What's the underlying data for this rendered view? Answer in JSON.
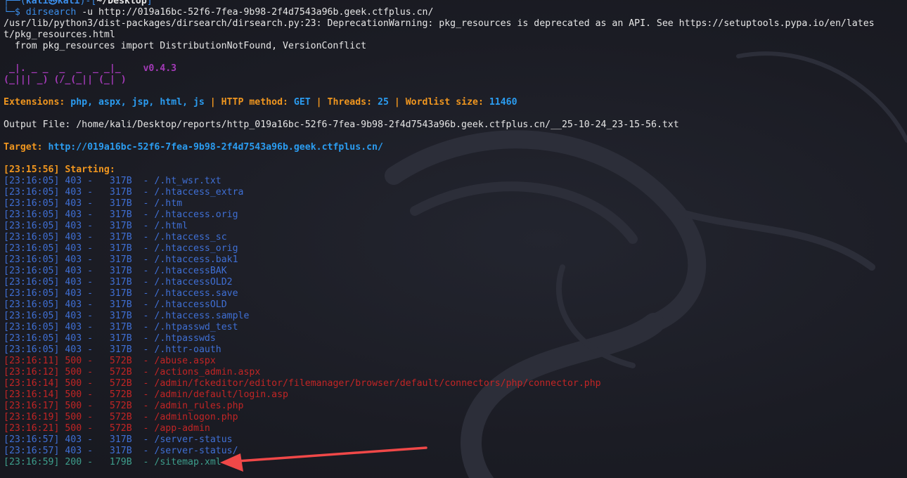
{
  "prompt": {
    "user": "kali",
    "at": "㉿",
    "host": "kali",
    "dir": "~/Desktop",
    "dollar": "$",
    "command": "dirsearch",
    "args": "-u http://019a16bc-52f6-7fea-9b98-2f4d7543a96b.geek.ctfplus.cn/"
  },
  "warning": {
    "line1": "/usr/lib/python3/dist-packages/dirsearch/dirsearch.py:23: DeprecationWarning: pkg_resources is deprecated as an API. See https://setuptools.pypa.io/en/lates",
    "line2": "t/pkg_resources.html",
    "line3": "  from pkg_resources import DistributionNotFound, VersionConflict"
  },
  "banner": {
    "art1": " _|. _ _  _  _  _ _|_    v0.4.3",
    "art2": "(_||| _) (/_(_|| (_| )"
  },
  "config": {
    "extensions_label": "Extensions: ",
    "extensions_value": "php, aspx, jsp, html, js",
    "method_label": "HTTP method: ",
    "method_value": "GET",
    "threads_label": "Threads: ",
    "threads_value": "25",
    "wordlist_label": "Wordlist size: ",
    "wordlist_value": "11460",
    "separator": " | "
  },
  "output_file": "Output File: /home/kali/Desktop/reports/http_019a16bc-52f6-7fea-9b98-2f4d7543a96b.geek.ctfplus.cn/__25-10-24_23-15-56.txt",
  "target": {
    "label": "Target: ",
    "url": "http://019a16bc-52f6-7fea-9b98-2f4d7543a96b.geek.ctfplus.cn/"
  },
  "starting": "[23:15:56] Starting: ",
  "results": [
    {
      "time": "[23:16:05]",
      "status": "403",
      "size": "317B",
      "path": "/.ht_wsr.txt",
      "color": "blue"
    },
    {
      "time": "[23:16:05]",
      "status": "403",
      "size": "317B",
      "path": "/.htaccess_extra",
      "color": "blue"
    },
    {
      "time": "[23:16:05]",
      "status": "403",
      "size": "317B",
      "path": "/.htm",
      "color": "blue"
    },
    {
      "time": "[23:16:05]",
      "status": "403",
      "size": "317B",
      "path": "/.htaccess.orig",
      "color": "blue"
    },
    {
      "time": "[23:16:05]",
      "status": "403",
      "size": "317B",
      "path": "/.html",
      "color": "blue"
    },
    {
      "time": "[23:16:05]",
      "status": "403",
      "size": "317B",
      "path": "/.htaccess_sc",
      "color": "blue"
    },
    {
      "time": "[23:16:05]",
      "status": "403",
      "size": "317B",
      "path": "/.htaccess_orig",
      "color": "blue"
    },
    {
      "time": "[23:16:05]",
      "status": "403",
      "size": "317B",
      "path": "/.htaccess.bak1",
      "color": "blue"
    },
    {
      "time": "[23:16:05]",
      "status": "403",
      "size": "317B",
      "path": "/.htaccessBAK",
      "color": "blue"
    },
    {
      "time": "[23:16:05]",
      "status": "403",
      "size": "317B",
      "path": "/.htaccessOLD2",
      "color": "blue"
    },
    {
      "time": "[23:16:05]",
      "status": "403",
      "size": "317B",
      "path": "/.htaccess.save",
      "color": "blue"
    },
    {
      "time": "[23:16:05]",
      "status": "403",
      "size": "317B",
      "path": "/.htaccessOLD",
      "color": "blue"
    },
    {
      "time": "[23:16:05]",
      "status": "403",
      "size": "317B",
      "path": "/.htaccess.sample",
      "color": "blue"
    },
    {
      "time": "[23:16:05]",
      "status": "403",
      "size": "317B",
      "path": "/.htpasswd_test",
      "color": "blue"
    },
    {
      "time": "[23:16:05]",
      "status": "403",
      "size": "317B",
      "path": "/.htpasswds",
      "color": "blue"
    },
    {
      "time": "[23:16:05]",
      "status": "403",
      "size": "317B",
      "path": "/.httr-oauth",
      "color": "blue"
    },
    {
      "time": "[23:16:11]",
      "status": "500",
      "size": "572B",
      "path": "/abuse.aspx",
      "color": "red"
    },
    {
      "time": "[23:16:12]",
      "status": "500",
      "size": "572B",
      "path": "/actions_admin.aspx",
      "color": "red"
    },
    {
      "time": "[23:16:14]",
      "status": "500",
      "size": "572B",
      "path": "/admin/fckeditor/editor/filemanager/browser/default/connectors/php/connector.php",
      "color": "red"
    },
    {
      "time": "[23:16:14]",
      "status": "500",
      "size": "572B",
      "path": "/admin/default/login.asp",
      "color": "red"
    },
    {
      "time": "[23:16:17]",
      "status": "500",
      "size": "572B",
      "path": "/admin_rules.php",
      "color": "red"
    },
    {
      "time": "[23:16:19]",
      "status": "500",
      "size": "572B",
      "path": "/adminlogon.php",
      "color": "red"
    },
    {
      "time": "[23:16:21]",
      "status": "500",
      "size": "572B",
      "path": "/app-admin",
      "color": "red"
    },
    {
      "time": "[23:16:57]",
      "status": "403",
      "size": "317B",
      "path": "/server-status",
      "color": "blue"
    },
    {
      "time": "[23:16:57]",
      "status": "403",
      "size": "317B",
      "path": "/server-status/",
      "color": "blue"
    },
    {
      "time": "[23:16:59]",
      "status": "200",
      "size": "179B",
      "path": "/sitemap.xml",
      "color": "green"
    }
  ],
  "colors": {
    "background": "#1c1d26",
    "status_403": "#3f6fd4",
    "status_500": "#c22525",
    "status_200": "#3d9e8c",
    "banner": "#a43ab8",
    "label": "#f0961f",
    "value": "#2b9cf0",
    "annotation_arrow": "#f04848"
  },
  "annotation": {
    "icon": "red-arrow-icon",
    "points_to": "/sitemap.xml"
  }
}
